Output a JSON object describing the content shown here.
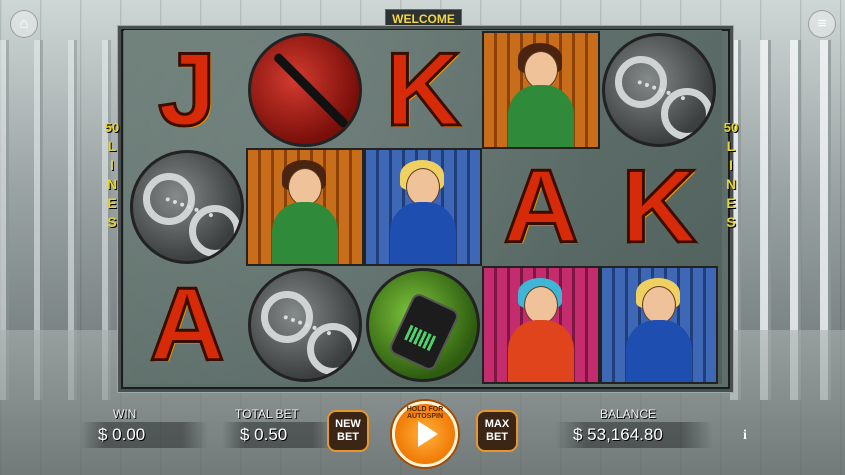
{
  "header": {
    "title": "WELCOME"
  },
  "lines_indicator": {
    "left": [
      "50",
      "L",
      "I",
      "N",
      "E",
      "S"
    ],
    "right": [
      "50",
      "L",
      "I",
      "N",
      "E",
      "S"
    ]
  },
  "grid": {
    "rows": [
      [
        "J",
        "baton",
        "K",
        "maid",
        "handcuffs"
      ],
      [
        "handcuffs",
        "maid",
        "guard",
        "A",
        "K"
      ],
      [
        "A",
        "handcuffs",
        "phone",
        "inmate",
        "guard"
      ]
    ]
  },
  "bottom": {
    "win_label": "WIN",
    "win_value": "$ 0.00",
    "total_bet_label": "TOTAL BET",
    "total_bet_value": "$ 0.50",
    "new_bet_label": "NEW BET",
    "spin_hint": "HOLD FOR AUTOSPIN",
    "max_bet_label": "MAX BET",
    "balance_label": "BALANCE",
    "balance_value": "$ 53,164.80",
    "info_label": "i"
  },
  "icons": {
    "home": "home-icon",
    "menu": "menu-icon",
    "spin": "play-icon"
  },
  "colors": {
    "accent": "#f07a05",
    "title_text": "#f3d64b",
    "letter": "#d62a08"
  }
}
